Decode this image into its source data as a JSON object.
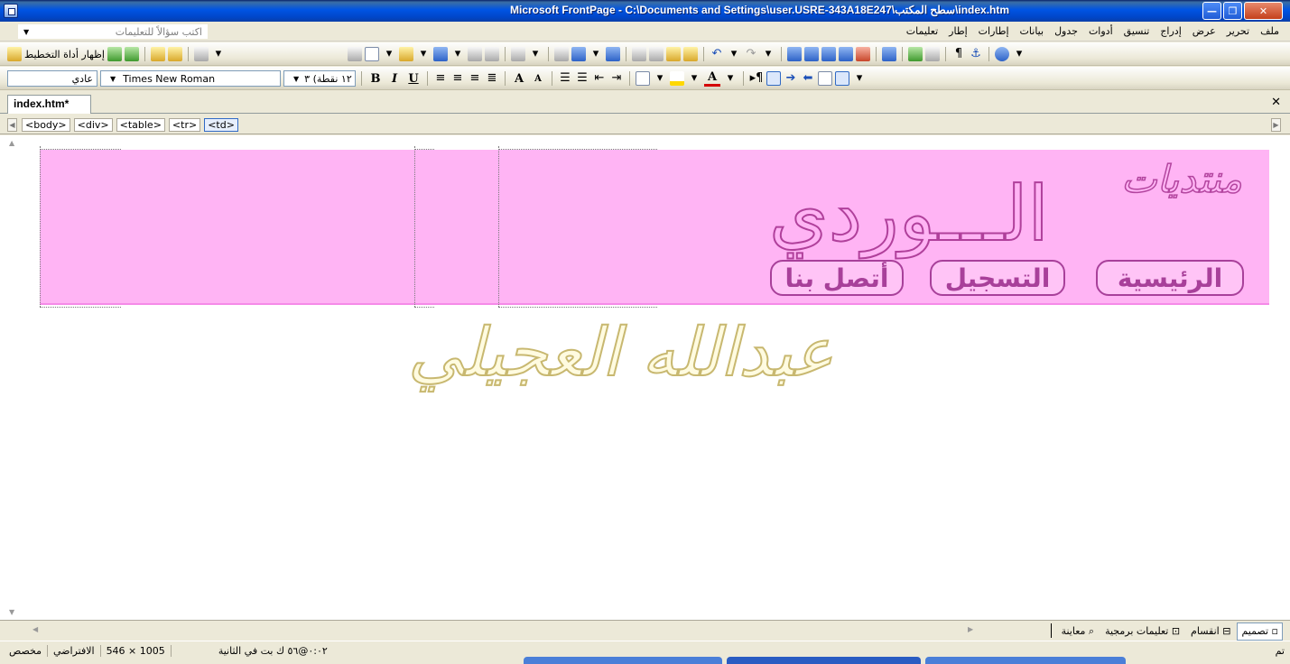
{
  "window": {
    "title": "Microsoft FrontPage - C:\\Documents and Settings\\user.USRE-343A18E247\\سطح المكتب\\index.htm",
    "minimize_label": "—",
    "maximize_label": "❐",
    "close_label": "✕"
  },
  "menu": {
    "items": [
      "ملف",
      "تحرير",
      "عرض",
      "إدراج",
      "تنسيق",
      "أدوات",
      "جدول",
      "بيانات",
      "إطارات",
      "إطار",
      "تعليمات"
    ],
    "ask_placeholder": "اكتب سؤالاً للتعليمات"
  },
  "toolbar": {
    "show_layout_tool": "إظهار أداة التخطيط"
  },
  "format_bar": {
    "style": "عادي",
    "font": "Times New Roman",
    "size": "١٢ نقطة) ٣"
  },
  "document": {
    "tab_label": "index.htm*",
    "tags": [
      "<body>",
      "<div>",
      "<table>",
      "<tr>",
      "<td>"
    ]
  },
  "page": {
    "logo_top": "منتديات",
    "logo_main": "الـــوردي",
    "nav": [
      "الرئيسية",
      "التسجيل",
      "أتصل بنا"
    ],
    "watermark": "عبدالله العجيلي"
  },
  "views": {
    "tabs": [
      "تصميم",
      "انقسام",
      "تعليمات برمجية",
      "معاينة"
    ],
    "active": "تصميم"
  },
  "status": {
    "speed": "٠:٠٢@٥٦ ك بت في الثانية",
    "dimensions": "1005 × 546",
    "default": "الافتراضي",
    "custom": "مخصص",
    "done": "تم"
  },
  "colors": {
    "header_bg": "#ffb4f4",
    "header_text": "#b0409b",
    "watermark_outline": "#c8b870"
  }
}
